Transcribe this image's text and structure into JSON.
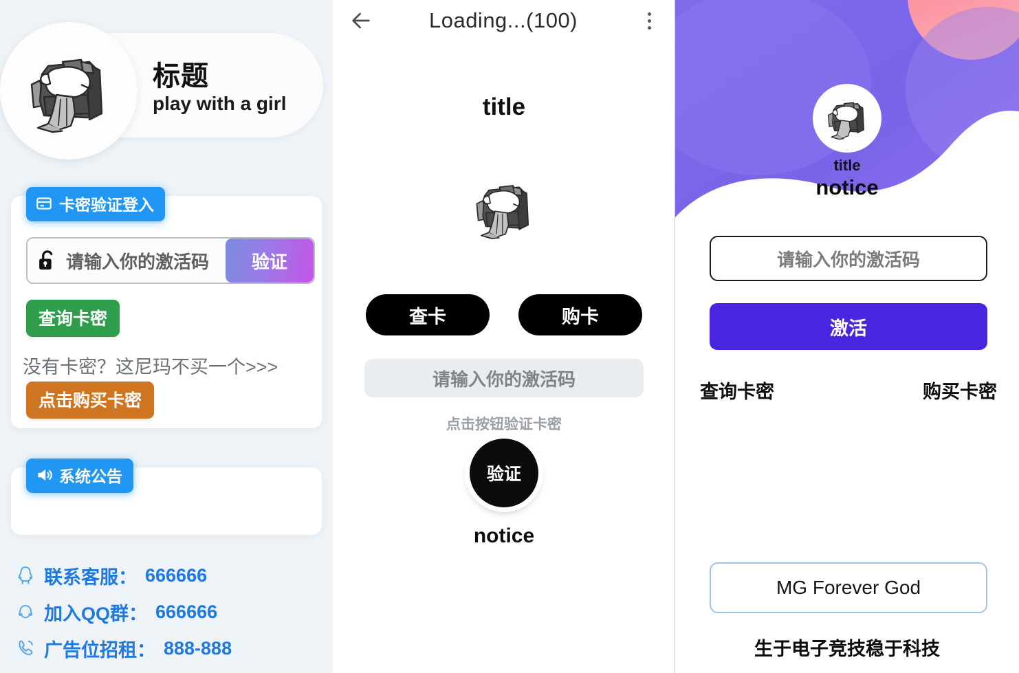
{
  "colors": {
    "brand_blue": "#2196f3",
    "green": "#2e9e4c",
    "orange": "#cf7420",
    "purple": "#4a25e0",
    "hero_purple": "#7a63e8",
    "hero_pink": "#fa8e9e",
    "link_blue": "#1f7ae0"
  },
  "panel_left": {
    "header": {
      "avatar_icon": "bear-on-couch-logo",
      "title": "标题",
      "subtitle": "play with a girl"
    },
    "login_card": {
      "badge": {
        "icon": "card-icon",
        "label": "卡密验证登入"
      },
      "code_input": {
        "icon": "lock-open-icon",
        "placeholder": "请输入你的激活码",
        "value": ""
      },
      "verify_button": "验证",
      "query_button": "查询卡密",
      "no_code_text": "没有卡密？这尼玛不买一个>>>",
      "buy_button": "点击购买卡密"
    },
    "notice_card": {
      "badge": {
        "icon": "speaker-icon",
        "label": "系统公告"
      },
      "body": ""
    },
    "contacts": [
      {
        "icon": "qq-penguin-icon",
        "label": "联系客服：",
        "value": "666666"
      },
      {
        "icon": "qq-group-icon",
        "label": "加入QQ群：",
        "value": "666666"
      },
      {
        "icon": "phone-icon",
        "label": "广告位招租：",
        "value": "888-888"
      }
    ]
  },
  "panel_middle": {
    "topbar": {
      "back_icon": "back-arrow-icon",
      "title": "Loading...(100)",
      "menu_icon": "more-vertical-icon"
    },
    "title": "title",
    "logo_icon": "bear-on-couch-logo",
    "buttons": {
      "check_card": "查卡",
      "buy_card": "购卡"
    },
    "input_placeholder": "请输入你的激活码",
    "hint": "点击按钮验证卡密",
    "verify_button": "验证",
    "notice": "notice"
  },
  "panel_right": {
    "hero": {
      "avatar_icon": "bear-on-couch-logo",
      "title": "title",
      "notice": "notice"
    },
    "input_placeholder": "请输入你的激活码",
    "activate_button": "激活",
    "links": {
      "query": "查询卡密",
      "buy": "购买卡密"
    },
    "footer_box": "MG Forever God",
    "footer_text": "生于电子竞技稳于科技"
  }
}
